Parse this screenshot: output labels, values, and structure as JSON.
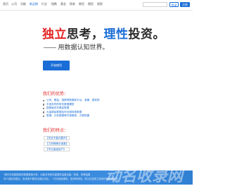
{
  "nav": {
    "items": [
      "首页",
      "公司",
      "功能",
      "新品期",
      "行业",
      "指数",
      "基金",
      "债券",
      "期货",
      "模型",
      "搜索"
    ],
    "active_index": 3,
    "login_label": "登录",
    "register_label": "注册"
  },
  "hero": {
    "title_red": "独立",
    "title_mid": "思考，",
    "title_blue": "理性",
    "title_end": "投资。",
    "subtitle": "—— 用数据认知世界。",
    "cta_label": "开始使用"
  },
  "advantages": {
    "title": "我们的优势：",
    "items": [
      "公司、基金、指数等数据库平台、准确、更新快",
      "丰富多样的财务数据模型",
      "国家级历年基金数据",
      "大量原始数据及时全部转换数据",
      "数据、分析数据等可视展现，方便快捷"
    ]
  },
  "features": {
    "title": "我们的特点：",
    "items": [
      "【完全不盈利展开】",
      "【力求精确无误差】",
      "【专业高级用户】"
    ]
  },
  "footer": {
    "line1": "*我们在各数据库的数据基础分析、功能本系统尽量提供高度功能、利用、体等结果",
    "line2": "本介绍投资建议，投资者不要依法做出决定。一切为独家拥有，投资有风险、所以在投资之前请仔细阅读信息",
    "watermark": "动名收录网"
  },
  "colors": {
    "accent_blue": "#1a6dd6",
    "accent_red": "#e32626",
    "footer_blue": "#3d8de0"
  }
}
